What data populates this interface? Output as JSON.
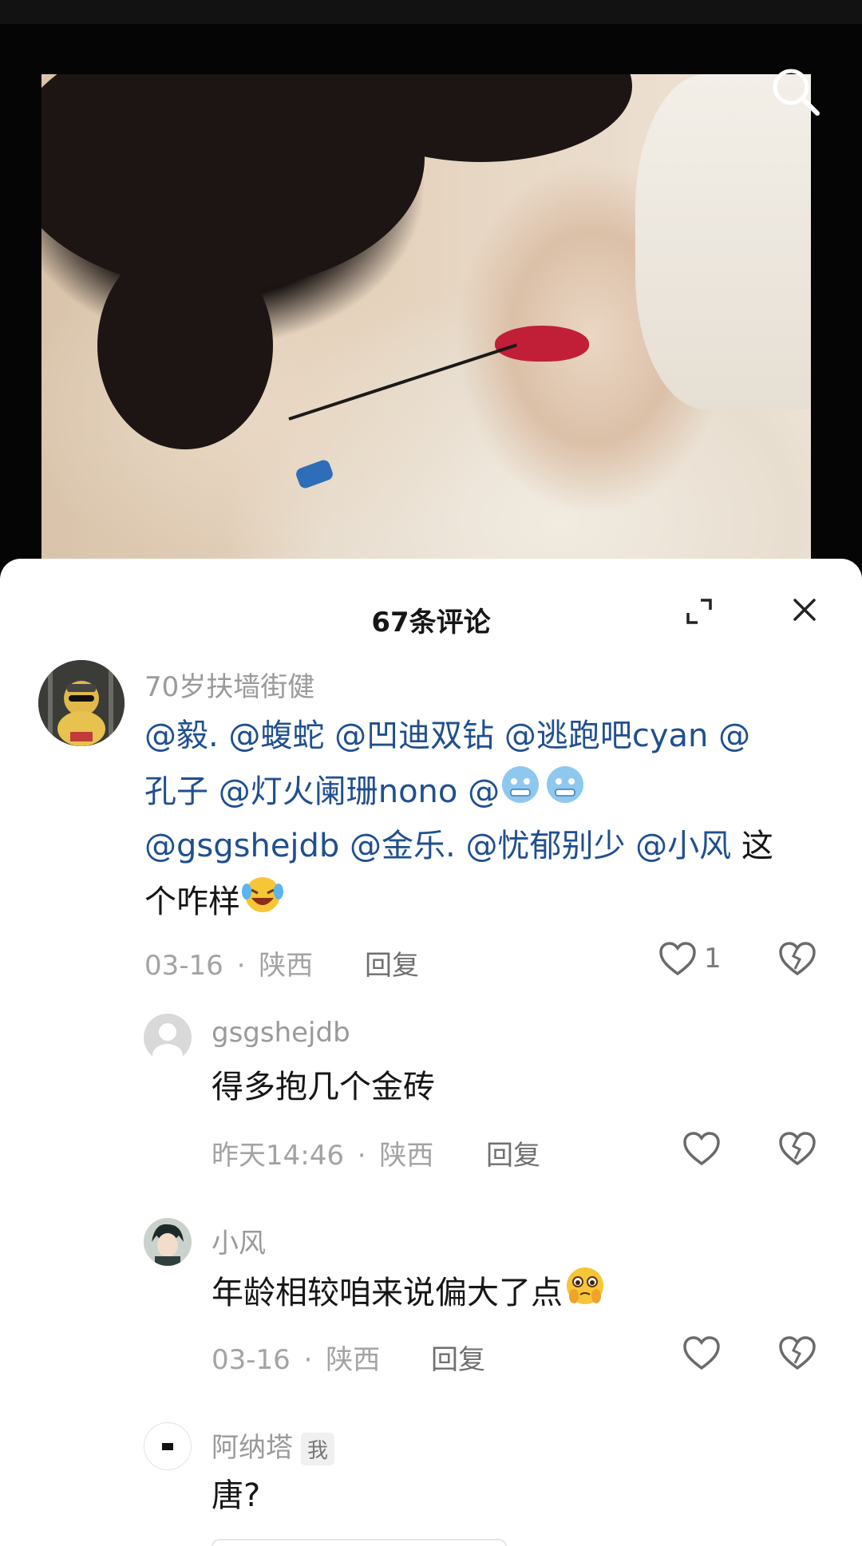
{
  "video": {
    "search_icon": "search-icon"
  },
  "sheet": {
    "title": "67条评论",
    "expand_icon": "expand-icon",
    "close_icon": "close-icon"
  },
  "comments": [
    {
      "username": "70岁扶墙街健",
      "mentions_line1": "@毅. @蝮蛇 @凹迪双钻 @逃跑吧cyan @",
      "mentions_line2a": "孔子 @灯火阑珊nono @",
      "mentions_line3": "@gsgshejdb @金乐. @忧郁别少 @小风",
      "plain_tail": "这",
      "line4": "个咋样",
      "date": "03-16",
      "separator": "·",
      "location": "陕西",
      "reply": "回复",
      "likes": "1"
    },
    {
      "username": "gsgshejdb",
      "text": "得多抱几个金砖",
      "date": "昨天14:46",
      "separator": "·",
      "location": "陕西",
      "reply": "回复"
    },
    {
      "username": "小风",
      "text": "年龄相较咱来说偏大了点",
      "date": "03-16",
      "separator": "·",
      "location": "陕西",
      "reply": "回复"
    },
    {
      "username": "阿纳塔",
      "badge": "我",
      "text": "唐?"
    }
  ],
  "colors": {
    "mention": "#1f4f8f",
    "meta": "#a3a3a3",
    "sheet_bg": "#ffffff"
  }
}
